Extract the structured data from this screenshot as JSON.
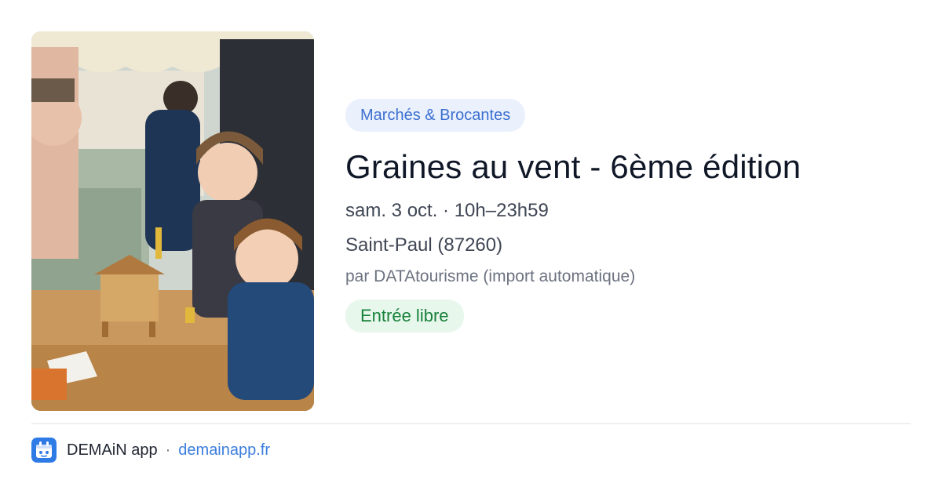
{
  "event": {
    "category": "Marchés & Brocantes",
    "title": "Graines au vent - 6ème édition",
    "datetime": "sam. 3 oct. · 10h–23h59",
    "location": "Saint-Paul (87260)",
    "source": "par DATAtourisme (import automatique)",
    "price": "Entrée libre"
  },
  "footer": {
    "app_name": "DEMAiN app",
    "separator": "·",
    "url": "demainapp.fr"
  },
  "colors": {
    "category_bg": "#eaf1fd",
    "category_text": "#3b6fd0",
    "price_bg": "#e8f7ec",
    "price_text": "#17813a",
    "link": "#3b7ddd",
    "app_icon": "#2f7be6"
  }
}
